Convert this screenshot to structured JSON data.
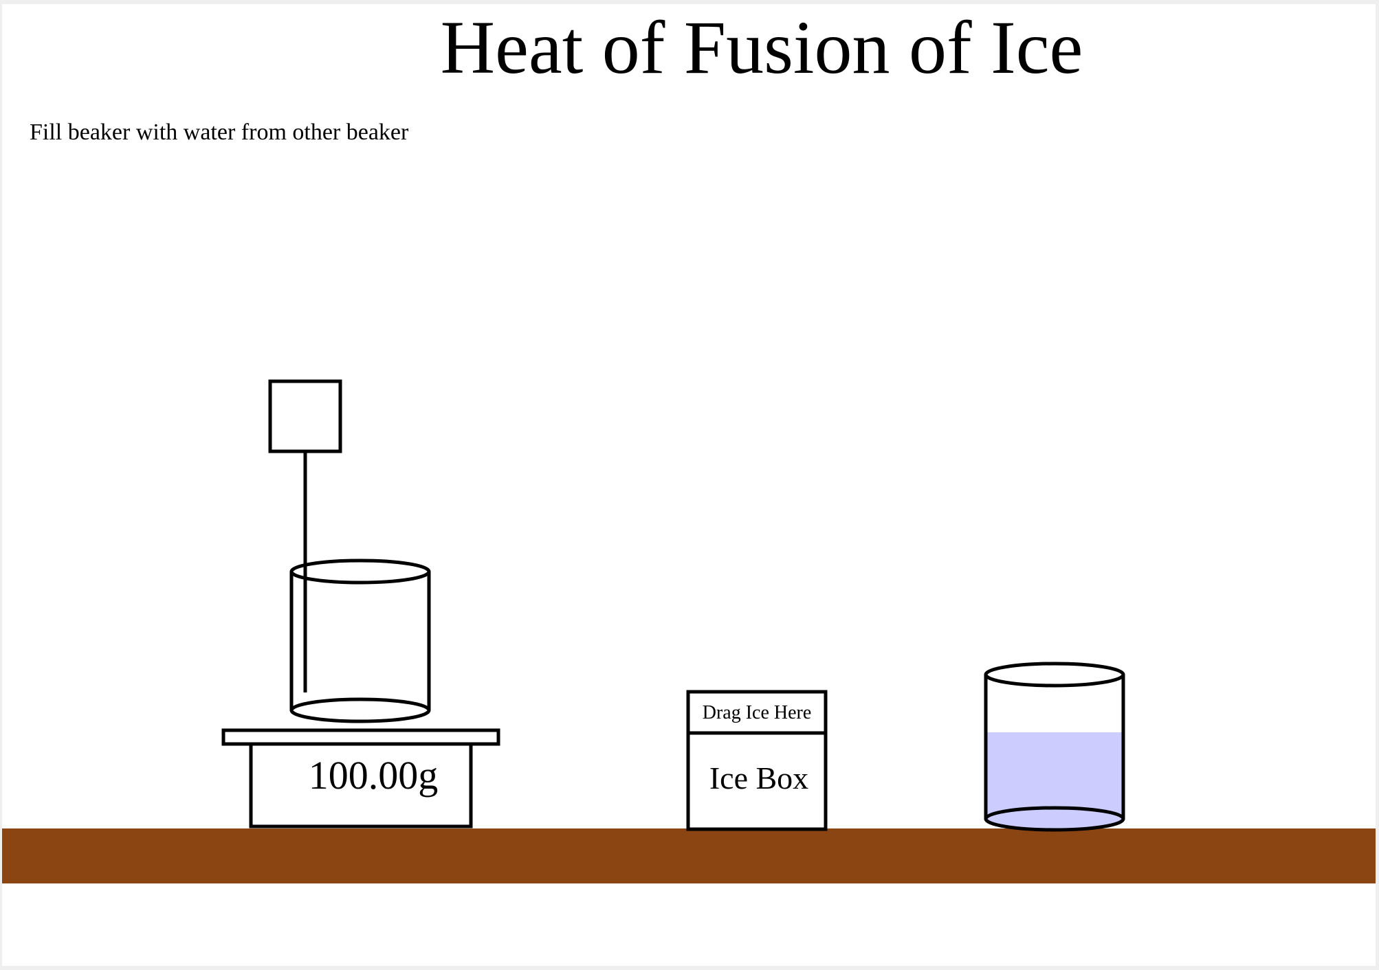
{
  "title": "Heat of Fusion of Ice",
  "instruction": "Fill beaker with water from other beaker",
  "scale": {
    "readout": "100.00g"
  },
  "ice_box": {
    "drop_label": "Drag Ice Here",
    "label": "Ice Box"
  },
  "water_beaker": {
    "fill_fraction": 0.6
  },
  "colors": {
    "table": "#8B4513",
    "water": "#CCCCFF",
    "outline": "#000000",
    "background": "#FFFFFF"
  }
}
